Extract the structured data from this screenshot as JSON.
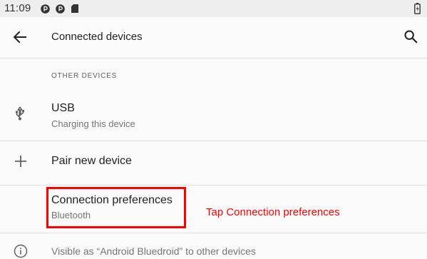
{
  "status_bar": {
    "time": "11:09",
    "icons": [
      "media-icon",
      "media-icon",
      "sd-card-icon",
      "battery-icon"
    ]
  },
  "app_bar": {
    "title": "Connected devices",
    "back_icon": "back-arrow-icon",
    "search_icon": "search-icon"
  },
  "section": {
    "header": "OTHER DEVICES"
  },
  "items": [
    {
      "icon": "usb-icon",
      "title": "USB",
      "subtitle": "Charging this device"
    },
    {
      "icon": "add-icon",
      "title": "Pair new device"
    },
    {
      "title": "Connection preferences",
      "subtitle": "Bluetooth"
    }
  ],
  "annotation": {
    "text": "Tap Connection preferences",
    "color": "#ff0000"
  },
  "footer": {
    "icon": "info-icon",
    "text": "Visible as “Android Bluedroid” to other devices"
  },
  "colors": {
    "background": "#fafafa",
    "status_bar": "#eeeeee",
    "primary_text": "#212121",
    "secondary_text": "#757575",
    "highlight": "#ff0000"
  }
}
